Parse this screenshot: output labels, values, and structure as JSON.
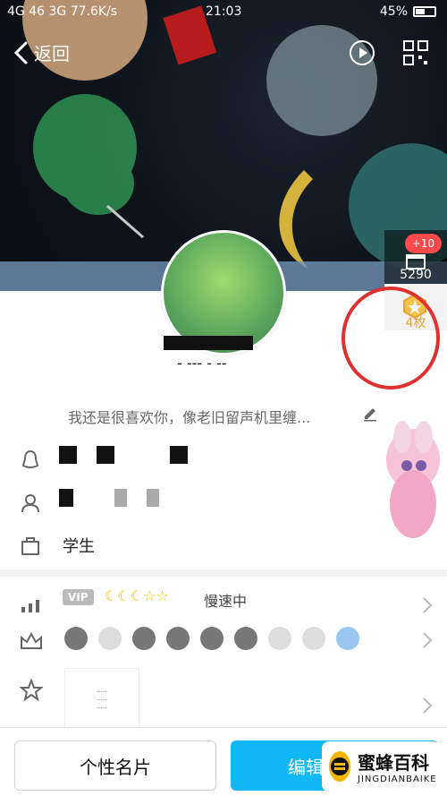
{
  "status": {
    "network": "4G 46 3G",
    "speed": "77.6K/s",
    "time": "21:03",
    "battery": "45%"
  },
  "topbar": {
    "back_label": "返回"
  },
  "right_rail": {
    "plus_badge": "+10",
    "top_count": "5290",
    "bottom_count": "4枚"
  },
  "profile": {
    "name_suffix": "- --- - --",
    "signature": "我还是很喜欢你，像老旧留声机里缠...",
    "info_text": "",
    "job": "学生"
  },
  "vip": {
    "label": "VIP",
    "moons": "☾☾☾☆☆",
    "speed_text": "慢速中"
  },
  "thumb": {
    "line1": "······",
    "line2": "······",
    "line3": "······"
  },
  "actions": {
    "card_label": "个性名片",
    "edit_label": "编辑"
  },
  "brand": {
    "title": "蜜蜂百科",
    "subtitle": "JINGDIANBAIKE"
  },
  "colors": {
    "accent_blue": "#12b7f5",
    "badge_red": "#ff4b4b",
    "gold": "#e3a72d",
    "circle_red": "#e03131"
  }
}
